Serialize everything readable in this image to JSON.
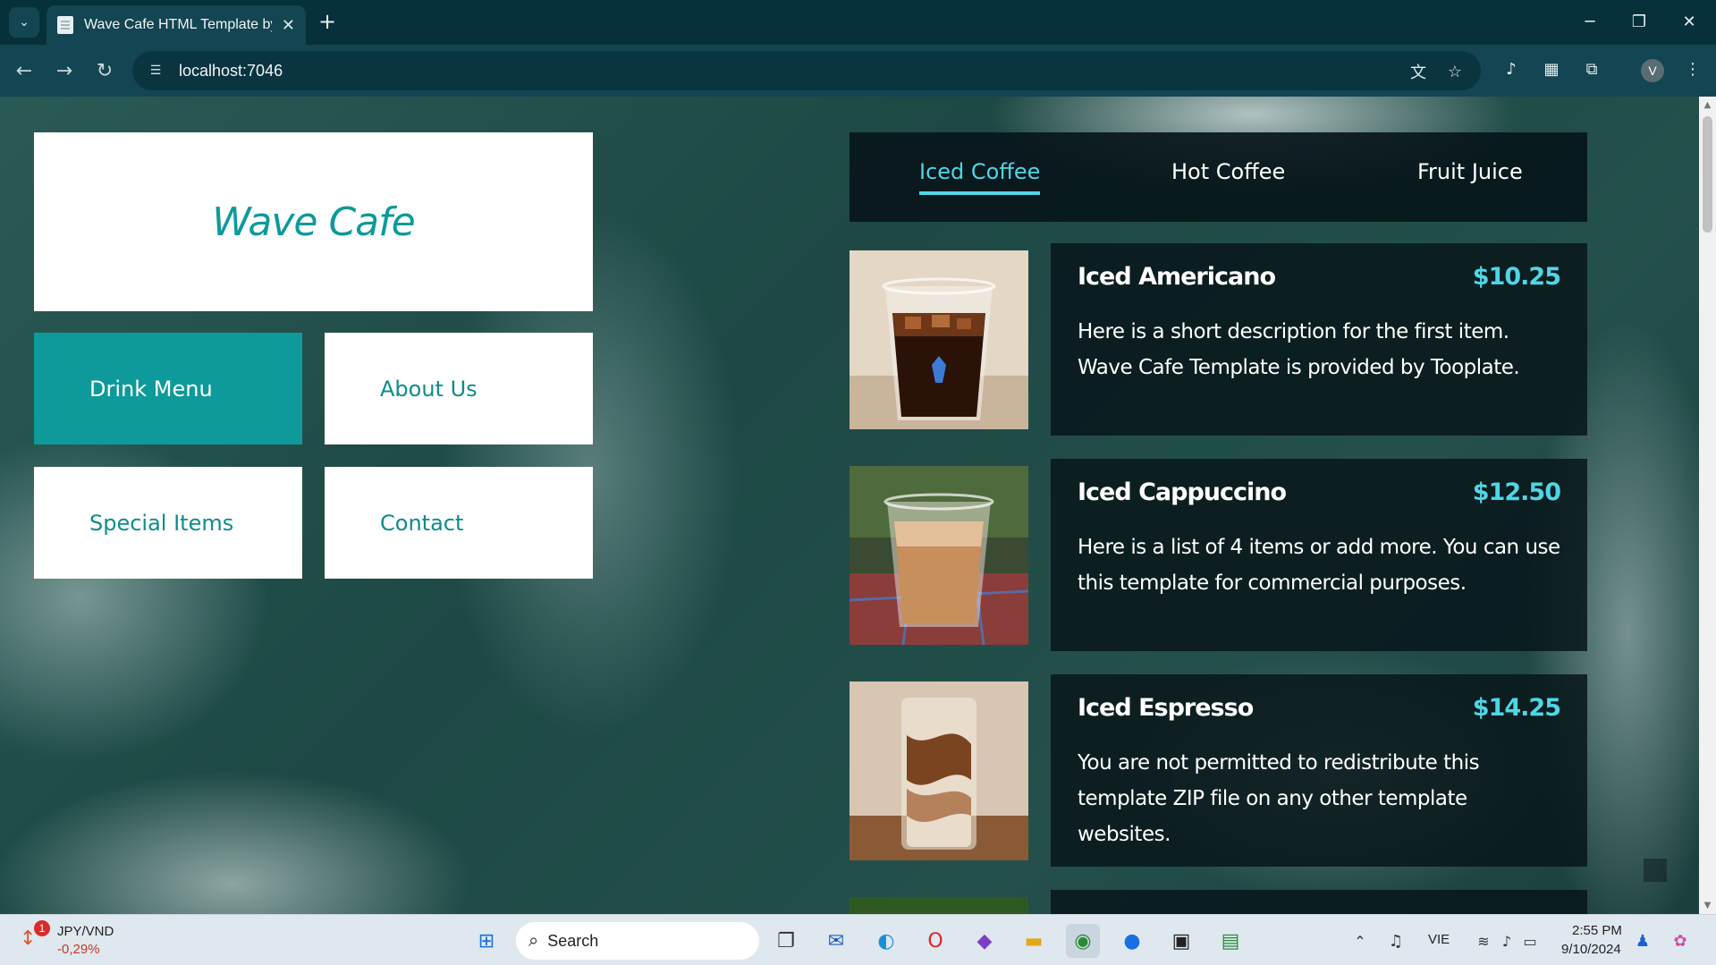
{
  "browser": {
    "tab_title": "Wave Cafe HTML Template by T",
    "url": "localhost:7046",
    "avatar_letter": "V"
  },
  "site": {
    "logo": "Wave Cafe",
    "nav": [
      "Drink Menu",
      "About Us",
      "Special Items",
      "Contact"
    ],
    "menu_tabs": [
      "Iced Coffee",
      "Hot Coffee",
      "Fruit Juice"
    ],
    "items": [
      {
        "name": "Iced Americano",
        "price": "$10.25",
        "desc": "Here is a short description for the first item. Wave Cafe Template is provided by Tooplate."
      },
      {
        "name": "Iced Cappuccino",
        "price": "$12.50",
        "desc": "Here is a list of 4 items or add more. You can use this template for commercial purposes."
      },
      {
        "name": "Iced Espresso",
        "price": "$14.25",
        "desc": "You are not permitted to redistribute this template ZIP file on any other template websites."
      }
    ]
  },
  "taskbar": {
    "widget_pair": "JPY/VND",
    "widget_change": "-0,29%",
    "widget_badge": "1",
    "search_placeholder": "Search",
    "language": "VIE",
    "time": "2:55 PM",
    "date": "9/10/2024"
  },
  "colors": {
    "accent": "#0e9a9a",
    "highlight": "#4fd6e6"
  }
}
